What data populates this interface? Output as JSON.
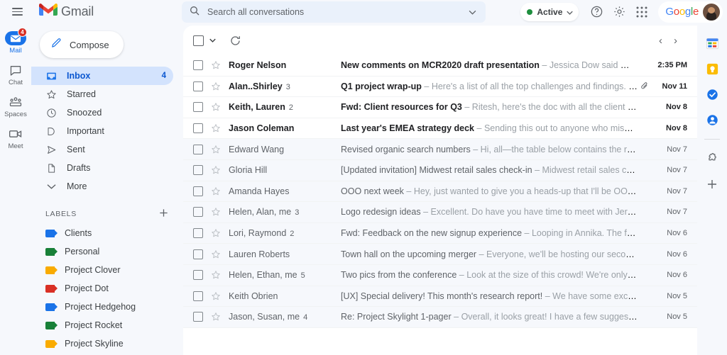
{
  "header": {
    "menu_icon": "hamburger-icon",
    "brand": "Gmail",
    "brand_icon": "gmail-logo-icon",
    "search": {
      "placeholder": "Search all conversations",
      "value": "",
      "icon": "search-icon",
      "options_icon": "chevron-down-icon"
    },
    "status": {
      "label": "Active",
      "dot_color": "#1e8e3e",
      "caret_icon": "chevron-down-icon"
    },
    "help_icon": "help-icon",
    "settings_icon": "gear-icon",
    "apps_icon": "apps-grid-icon",
    "google_logo": "Google",
    "avatar": "user-avatar"
  },
  "rail": {
    "items": [
      {
        "label": "Mail",
        "icon": "mail-icon",
        "badge": "4",
        "active": true
      },
      {
        "label": "Chat",
        "icon": "chat-icon",
        "badge": "",
        "active": false
      },
      {
        "label": "Spaces",
        "icon": "spaces-icon",
        "badge": "",
        "active": false
      },
      {
        "label": "Meet",
        "icon": "meet-icon",
        "badge": "",
        "active": false
      }
    ]
  },
  "sidebar": {
    "compose": {
      "label": "Compose",
      "icon": "pencil-icon"
    },
    "nav": [
      {
        "label": "Inbox",
        "icon": "inbox-icon",
        "count": "4",
        "active": true
      },
      {
        "label": "Starred",
        "icon": "star-icon",
        "count": "",
        "active": false
      },
      {
        "label": "Snoozed",
        "icon": "clock-icon",
        "count": "",
        "active": false
      },
      {
        "label": "Important",
        "icon": "important-icon",
        "count": "",
        "active": false
      },
      {
        "label": "Sent",
        "icon": "send-icon",
        "count": "",
        "active": false
      },
      {
        "label": "Drafts",
        "icon": "draft-icon",
        "count": "",
        "active": false
      },
      {
        "label": "More",
        "icon": "chevron-down-icon",
        "count": "",
        "active": false
      }
    ],
    "labels_title": "LABELS",
    "labels_add_icon": "plus-icon",
    "labels": [
      {
        "name": "Clients",
        "color": "#1a73e8"
      },
      {
        "name": "Personal",
        "color": "#188038"
      },
      {
        "name": "Project Clover",
        "color": "#f9ab00"
      },
      {
        "name": "Project Dot",
        "color": "#d93025"
      },
      {
        "name": "Project Hedgehog",
        "color": "#1a73e8"
      },
      {
        "name": "Project Rocket",
        "color": "#188038"
      },
      {
        "name": "Project Skyline",
        "color": "#f9ab00"
      }
    ]
  },
  "toolbar": {
    "select_all_icon": "checkbox-icon",
    "select_caret_icon": "chevron-down-icon",
    "refresh_icon": "refresh-icon",
    "prev_icon": "chevron-left-icon",
    "next_icon": "chevron-right-icon"
  },
  "email_list": [
    {
      "sender": "Roger Nelson",
      "count": "",
      "subject": "New comments on MCR2020 draft presentation",
      "snippet": "Jessica Dow said What about Eva...",
      "date": "2:35 PM",
      "unread": true,
      "attachment": false
    },
    {
      "sender": "Alan..Shirley",
      "count": "3",
      "subject": "Q1 project wrap-up",
      "snippet": "Here's a list of all the top challenges and findings. Surprisi...",
      "date": "Nov 11",
      "unread": true,
      "attachment": true
    },
    {
      "sender": "Keith, Lauren",
      "count": "2",
      "subject": "Fwd: Client resources for Q3",
      "snippet": "Ritesh, here's the doc with all the client resource links ...",
      "date": "Nov 8",
      "unread": true,
      "attachment": false
    },
    {
      "sender": "Jason Coleman",
      "count": "",
      "subject": "Last year's EMEA strategy deck",
      "snippet": "Sending this out to anyone who missed it. Really gr...",
      "date": "Nov 8",
      "unread": true,
      "attachment": false
    },
    {
      "sender": "Edward Wang",
      "count": "",
      "subject": "Revised organic search numbers",
      "snippet": "Hi, all—the table below contains the revised numbe...",
      "date": "Nov 7",
      "unread": false,
      "attachment": false
    },
    {
      "sender": "Gloria Hill",
      "count": "",
      "subject": "[Updated invitation] Midwest retail sales check-in",
      "snippet": "Midwest retail sales check-in @ Tu...",
      "date": "Nov 7",
      "unread": false,
      "attachment": false
    },
    {
      "sender": "Amanda Hayes",
      "count": "",
      "subject": "OOO next week",
      "snippet": "Hey, just wanted to give you a heads-up that I'll be OOO next week. If ...",
      "date": "Nov 7",
      "unread": false,
      "attachment": false
    },
    {
      "sender": "Helen, Alan, me",
      "count": "3",
      "subject": "Logo redesign ideas",
      "snippet": "Excellent. Do have you have time to meet with Jeroen and me thi...",
      "date": "Nov 7",
      "unread": false,
      "attachment": false
    },
    {
      "sender": "Lori, Raymond",
      "count": "2",
      "subject": "Fwd: Feedback on the new signup experience",
      "snippet": "Looping in Annika. The feedback we've...",
      "date": "Nov 6",
      "unread": false,
      "attachment": false
    },
    {
      "sender": "Lauren Roberts",
      "count": "",
      "subject": "Town hall on the upcoming merger",
      "snippet": "Everyone, we'll be hosting our second town hall to ...",
      "date": "Nov 6",
      "unread": false,
      "attachment": false
    },
    {
      "sender": "Helen, Ethan, me",
      "count": "5",
      "subject": "Two pics from the conference",
      "snippet": "Look at the size of this crowd! We're only halfway throu...",
      "date": "Nov 6",
      "unread": false,
      "attachment": false
    },
    {
      "sender": "Keith Obrien",
      "count": "",
      "subject": "[UX] Special delivery! This month's research report!",
      "snippet": "We have some exciting stuff to sh...",
      "date": "Nov 5",
      "unread": false,
      "attachment": false
    },
    {
      "sender": "Jason, Susan, me",
      "count": "4",
      "subject": "Re: Project Skylight 1-pager",
      "snippet": "Overall, it looks great! I have a few suggestions for what t...",
      "date": "Nov 5",
      "unread": false,
      "attachment": false
    }
  ],
  "rightbar": {
    "items": [
      {
        "icon": "calendar-icon"
      },
      {
        "icon": "keep-icon"
      },
      {
        "icon": "tasks-icon"
      },
      {
        "icon": "contacts-icon"
      }
    ],
    "addon_icon": "puzzle-addon-icon",
    "add_icon": "plus-icon"
  }
}
